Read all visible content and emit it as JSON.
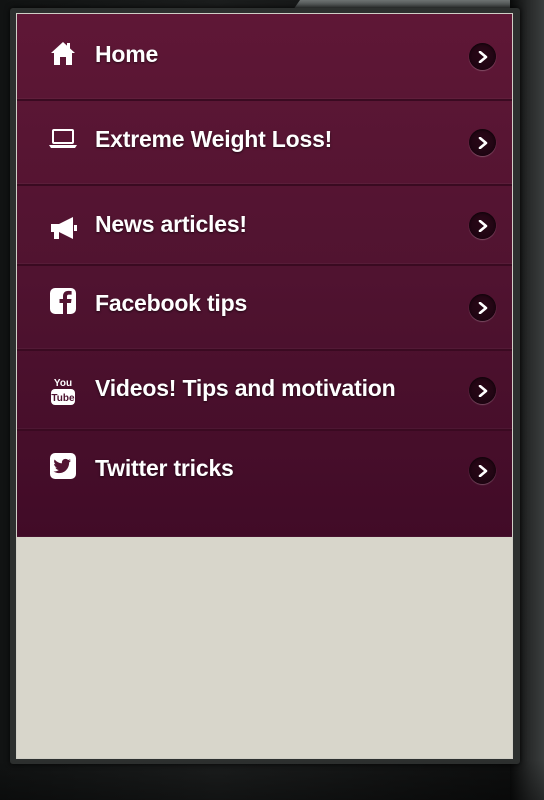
{
  "menu": {
    "items": [
      {
        "label": "Home",
        "icon": "home-icon"
      },
      {
        "label": "Extreme Weight Loss!",
        "icon": "laptop-icon"
      },
      {
        "label": "News articles!",
        "icon": "megaphone-icon"
      },
      {
        "label": "Facebook tips",
        "icon": "facebook-icon"
      },
      {
        "label": "Videos! Tips and motivation",
        "icon": "youtube-icon"
      },
      {
        "label": "Twitter tricks",
        "icon": "twitter-icon"
      }
    ]
  },
  "colors": {
    "menu_background": "#5a1534",
    "content_background": "#d8d6cb",
    "label_text": "#ffffff",
    "chevron_background": "#1f0512"
  }
}
